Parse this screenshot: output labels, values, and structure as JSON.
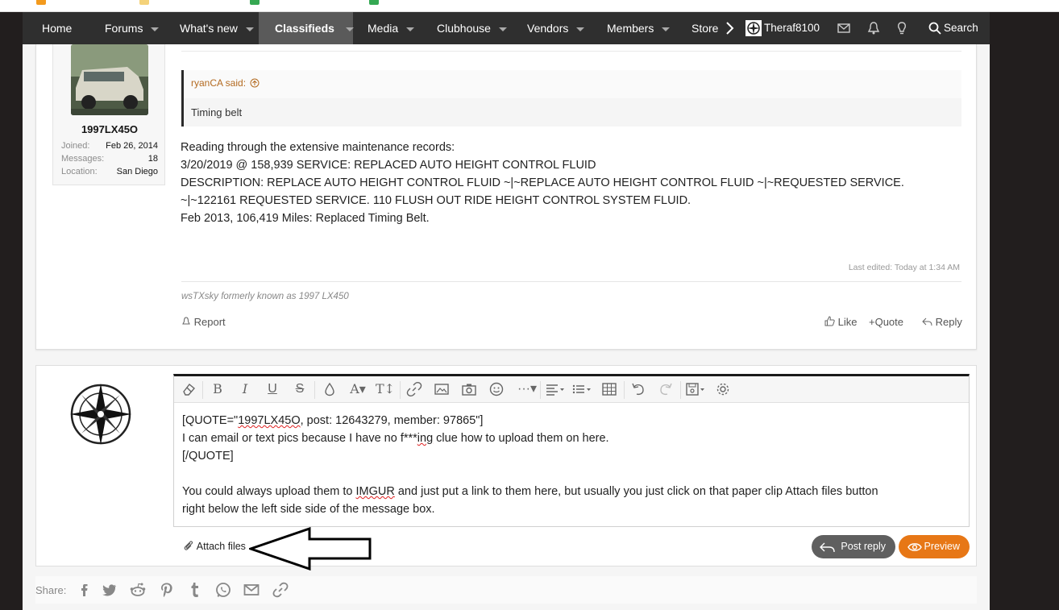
{
  "nav": {
    "items": [
      {
        "label": "Home",
        "has_dropdown": false,
        "active": false
      },
      {
        "label": "Forums",
        "has_dropdown": true,
        "active": false
      },
      {
        "label": "What's new",
        "has_dropdown": true,
        "active": false
      },
      {
        "label": "Classifieds",
        "has_dropdown": true,
        "active": true
      },
      {
        "label": "Media",
        "has_dropdown": true,
        "active": false
      },
      {
        "label": "Clubhouse",
        "has_dropdown": true,
        "active": false
      },
      {
        "label": "Vendors",
        "has_dropdown": true,
        "active": false
      },
      {
        "label": "Members",
        "has_dropdown": true,
        "active": false
      },
      {
        "label": "Store",
        "has_dropdown": false,
        "active": false
      }
    ],
    "username": "Theraf8100",
    "search_label": "Search"
  },
  "post": {
    "author": "1997LX45O",
    "stats": [
      {
        "label": "Joined:",
        "value": "Feb 26, 2014"
      },
      {
        "label": "Messages:",
        "value": "18"
      },
      {
        "label": "Location:",
        "value": "San Diego"
      }
    ],
    "quote_author": "ryanCA said:",
    "quote_text": "Timing belt",
    "message_lines": [
      "Reading through the extensive maintenance records:",
      "3/20/2019 @ 158,939 SERVICE: REPLACED AUTO HEIGHT CONTROL FLUID",
      "DESCRIPTION: REPLACE AUTO HEIGHT CONTROL FLUID ~|~REPLACE AUTO HEIGHT CONTROL FLUID ~|~REQUESTED SERVICE.",
      "~|~122161 REQUESTED SERVICE. 110 FLUSH OUT RIDE HEIGHT CONTROL SYSTEM FLUID.",
      "Feb 2013, 106,419 Miles: Replaced Timing Belt."
    ],
    "last_edited": "Last edited: Today at 1:34 AM",
    "signature": "wsTXsky formerly known as 1997 LX450",
    "report_label": "Report",
    "like_label": "Like",
    "quote_label": "+Quote",
    "reply_label": "Reply"
  },
  "reply_box": {
    "line1_prefix": "[QUOTE=\"",
    "line1_name": "1997LX45O",
    "line1_suffix": ", post: 12643279, member: 97865\"]",
    "line2_prefix": " I can email or text pics because I have no f***",
    "line2_word": "ing",
    "line2_suffix": " clue how to upload them on here.",
    "line3": "[/QUOTE]",
    "line4_prefix": "You could always upload them to ",
    "line4_word": "IMGUR",
    "line4_suffix": " and just put a link to them here, but usually you just click on that paper clip Attach files button",
    "line5": "right below the left side side of the message box.",
    "attach_label": "Attach files",
    "post_reply_label": "Post reply",
    "preview_label": "Preview"
  },
  "share": {
    "label": "Share:",
    "icons": [
      "facebook-icon",
      "twitter-icon",
      "reddit-icon",
      "pinterest-icon",
      "tumblr-icon",
      "whatsapp-icon",
      "email-icon",
      "link-icon"
    ]
  },
  "colors": {
    "navbar_bg": "#2f2f2f",
    "active_tab_bg": "#5a5a5a",
    "accent_orange": "#e77716",
    "quote_author_color": "#b36a20",
    "frame_dark": "#221e1e"
  }
}
